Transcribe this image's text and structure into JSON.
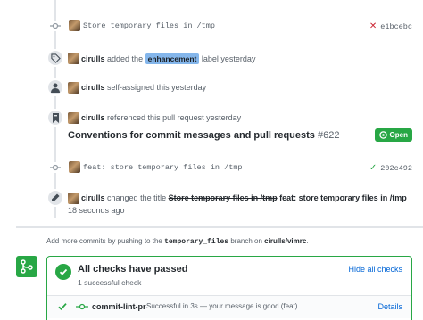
{
  "timeline": {
    "commit1": {
      "message": "Store temporary files in /tmp",
      "sha": "e1bcebc",
      "status": "failure"
    },
    "labeled": {
      "actor": "cirulls",
      "pre": "added the",
      "label": "enhancement",
      "post": "label yesterday",
      "label_color": "#84b6eb"
    },
    "assigned": {
      "actor": "cirulls",
      "text": "self-assigned this yesterday"
    },
    "referenced": {
      "actor": "cirulls",
      "text": "referenced this pull request yesterday",
      "title": "Conventions for commit messages and pull requests",
      "number": "#622",
      "state": "Open"
    },
    "commit2": {
      "message": "feat: store temporary files in /tmp",
      "sha": "202c492",
      "status": "success"
    },
    "renamed": {
      "actor": "cirulls",
      "pre": "changed the title",
      "old_title": "Store temporary files in /tmp",
      "new_title": "feat: store temporary files in /tmp",
      "time": "18 seconds ago"
    }
  },
  "hint": {
    "pre": "Add more commits by pushing to the",
    "branch": "temporary_files",
    "mid": "branch on",
    "repo": "cirulls/vimrc",
    "post": "."
  },
  "checks": {
    "title": "All checks have passed",
    "subtitle": "1 successful check",
    "hide_label": "Hide all checks",
    "rows": [
      {
        "name": "commit-lint-pr",
        "description": "Successful in 3s — your message is good (feat)",
        "details_label": "Details"
      }
    ]
  },
  "colors": {
    "success": "#28a745",
    "failure": "#cb2431",
    "link": "#0366d6",
    "muted": "#586069",
    "line": "#e1e4e8"
  }
}
